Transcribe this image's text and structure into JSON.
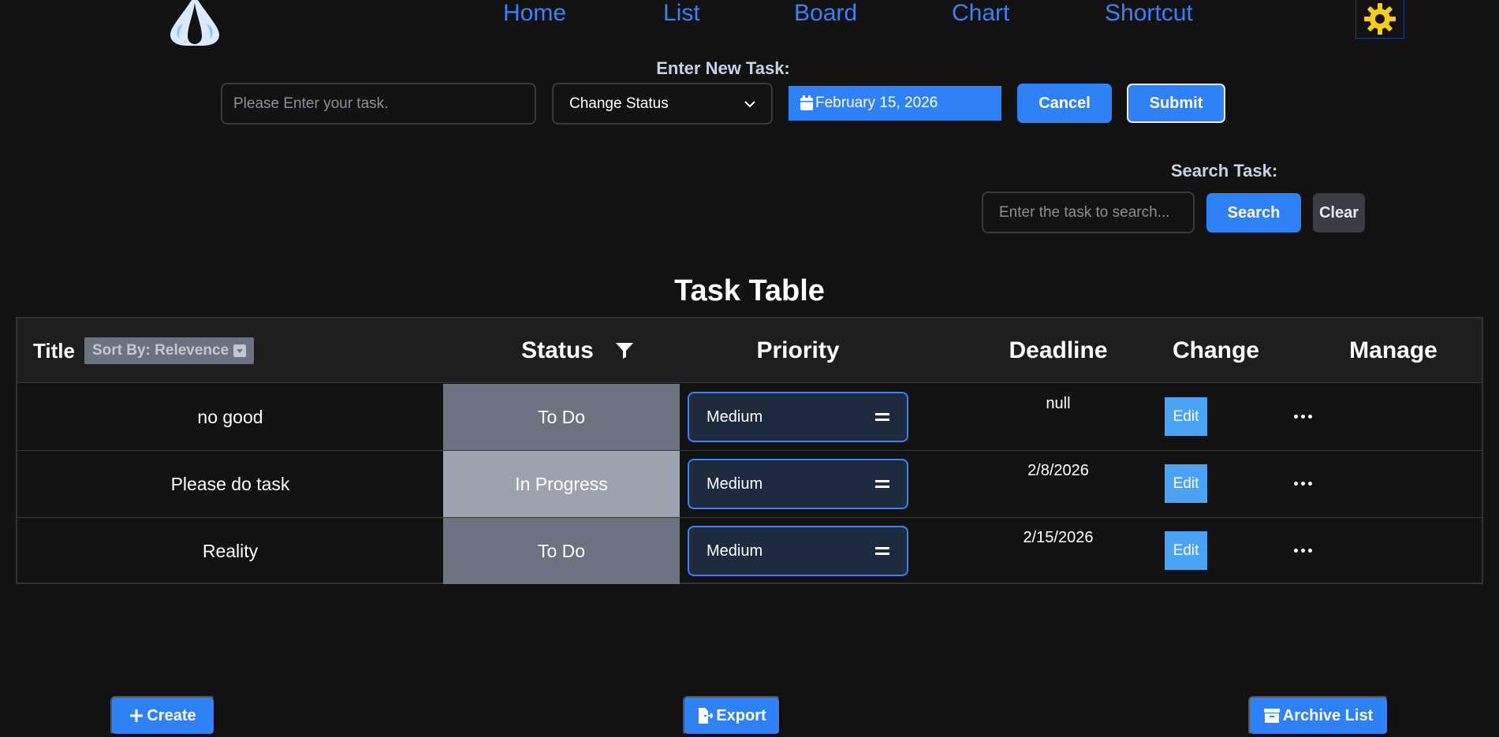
{
  "nav": {
    "items": [
      "Home",
      "List",
      "Board",
      "Chart",
      "Shortcut"
    ]
  },
  "new_task": {
    "label": "Enter New Task:",
    "placeholder": "Please Enter your task.",
    "status_select": "Change Status",
    "date": "February 15, 2026",
    "cancel": "Cancel",
    "submit": "Submit"
  },
  "search": {
    "label": "Search Task:",
    "placeholder": "Enter the task to search...",
    "search_btn": "Search",
    "clear_btn": "Clear"
  },
  "table": {
    "title": "Task Table",
    "headers": {
      "title": "Title",
      "sort": "Sort By: Relevence",
      "status": "Status",
      "priority": "Priority",
      "deadline": "Deadline",
      "change": "Change",
      "manage": "Manage"
    },
    "rows": [
      {
        "title": "no good",
        "status": "To Do",
        "priority": "Medium",
        "deadline": "null",
        "edit": "Edit"
      },
      {
        "title": "Please do task",
        "status": "In Progress",
        "priority": "Medium",
        "deadline": "2/8/2026",
        "edit": "Edit"
      },
      {
        "title": "Reality",
        "status": "To Do",
        "priority": "Medium",
        "deadline": "2/15/2026",
        "edit": "Edit"
      }
    ],
    "status_colors": {
      "To Do": "#6b7280",
      "In Progress": "#9ca3af"
    }
  },
  "bottom": {
    "create": "Create",
    "export": "Export",
    "archive": "Archive List"
  },
  "colors": {
    "accent": "#2f81f7",
    "background": "#121212",
    "gear": "#facc15"
  },
  "icons": [
    "drop-logo-icon",
    "gear-icon",
    "calendar-icon",
    "filter-icon",
    "caret-down-icon",
    "equals-icon",
    "more-icon",
    "plus-icon",
    "file-export-icon",
    "archive-icon"
  ]
}
